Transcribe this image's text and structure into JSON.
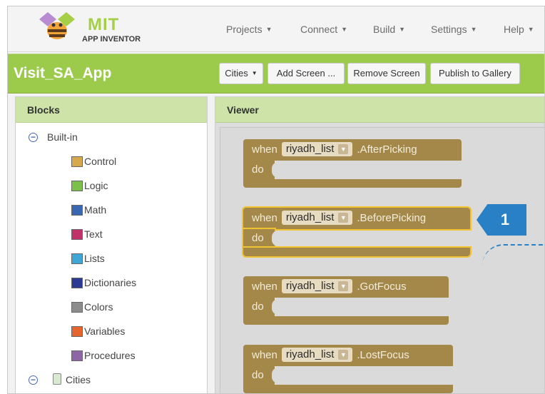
{
  "topbar": {
    "logo_title": "MIT",
    "logo_subtitle": "APP INVENTOR",
    "menus": [
      "Projects",
      "Connect",
      "Build",
      "Settings",
      "Help"
    ]
  },
  "project": {
    "name": "Visit_SA_App",
    "screen_selector": "Cities",
    "add_screen": "Add Screen ...",
    "remove_screen": "Remove Screen",
    "publish": "Publish to Gallery"
  },
  "blocks_panel": {
    "title": "Blocks",
    "builtin_label": "Built-in",
    "categories": [
      {
        "label": "Control",
        "color": "#d6a94d"
      },
      {
        "label": "Logic",
        "color": "#7bc04b"
      },
      {
        "label": "Math",
        "color": "#3a67b2"
      },
      {
        "label": "Text",
        "color": "#c3316b"
      },
      {
        "label": "Lists",
        "color": "#3fa7d6"
      },
      {
        "label": "Dictionaries",
        "color": "#2c3a93"
      },
      {
        "label": "Colors",
        "color": "#8c8c8c"
      },
      {
        "label": "Variables",
        "color": "#e5652d"
      },
      {
        "label": "Procedures",
        "color": "#8e66a6"
      }
    ],
    "component_label": "Cities"
  },
  "viewer": {
    "title": "Viewer",
    "blocks": [
      {
        "when": "when",
        "component": "riyadh_list",
        "event": ".AfterPicking",
        "do": "do"
      },
      {
        "when": "when",
        "component": "riyadh_list",
        "event": ".BeforePicking",
        "do": "do"
      },
      {
        "when": "when",
        "component": "riyadh_list",
        "event": ".GotFocus",
        "do": "do"
      },
      {
        "when": "when",
        "component": "riyadh_list",
        "event": ".LostFocus",
        "do": "do"
      }
    ]
  },
  "callout": {
    "number": "1",
    "color": "#2a80c5"
  }
}
